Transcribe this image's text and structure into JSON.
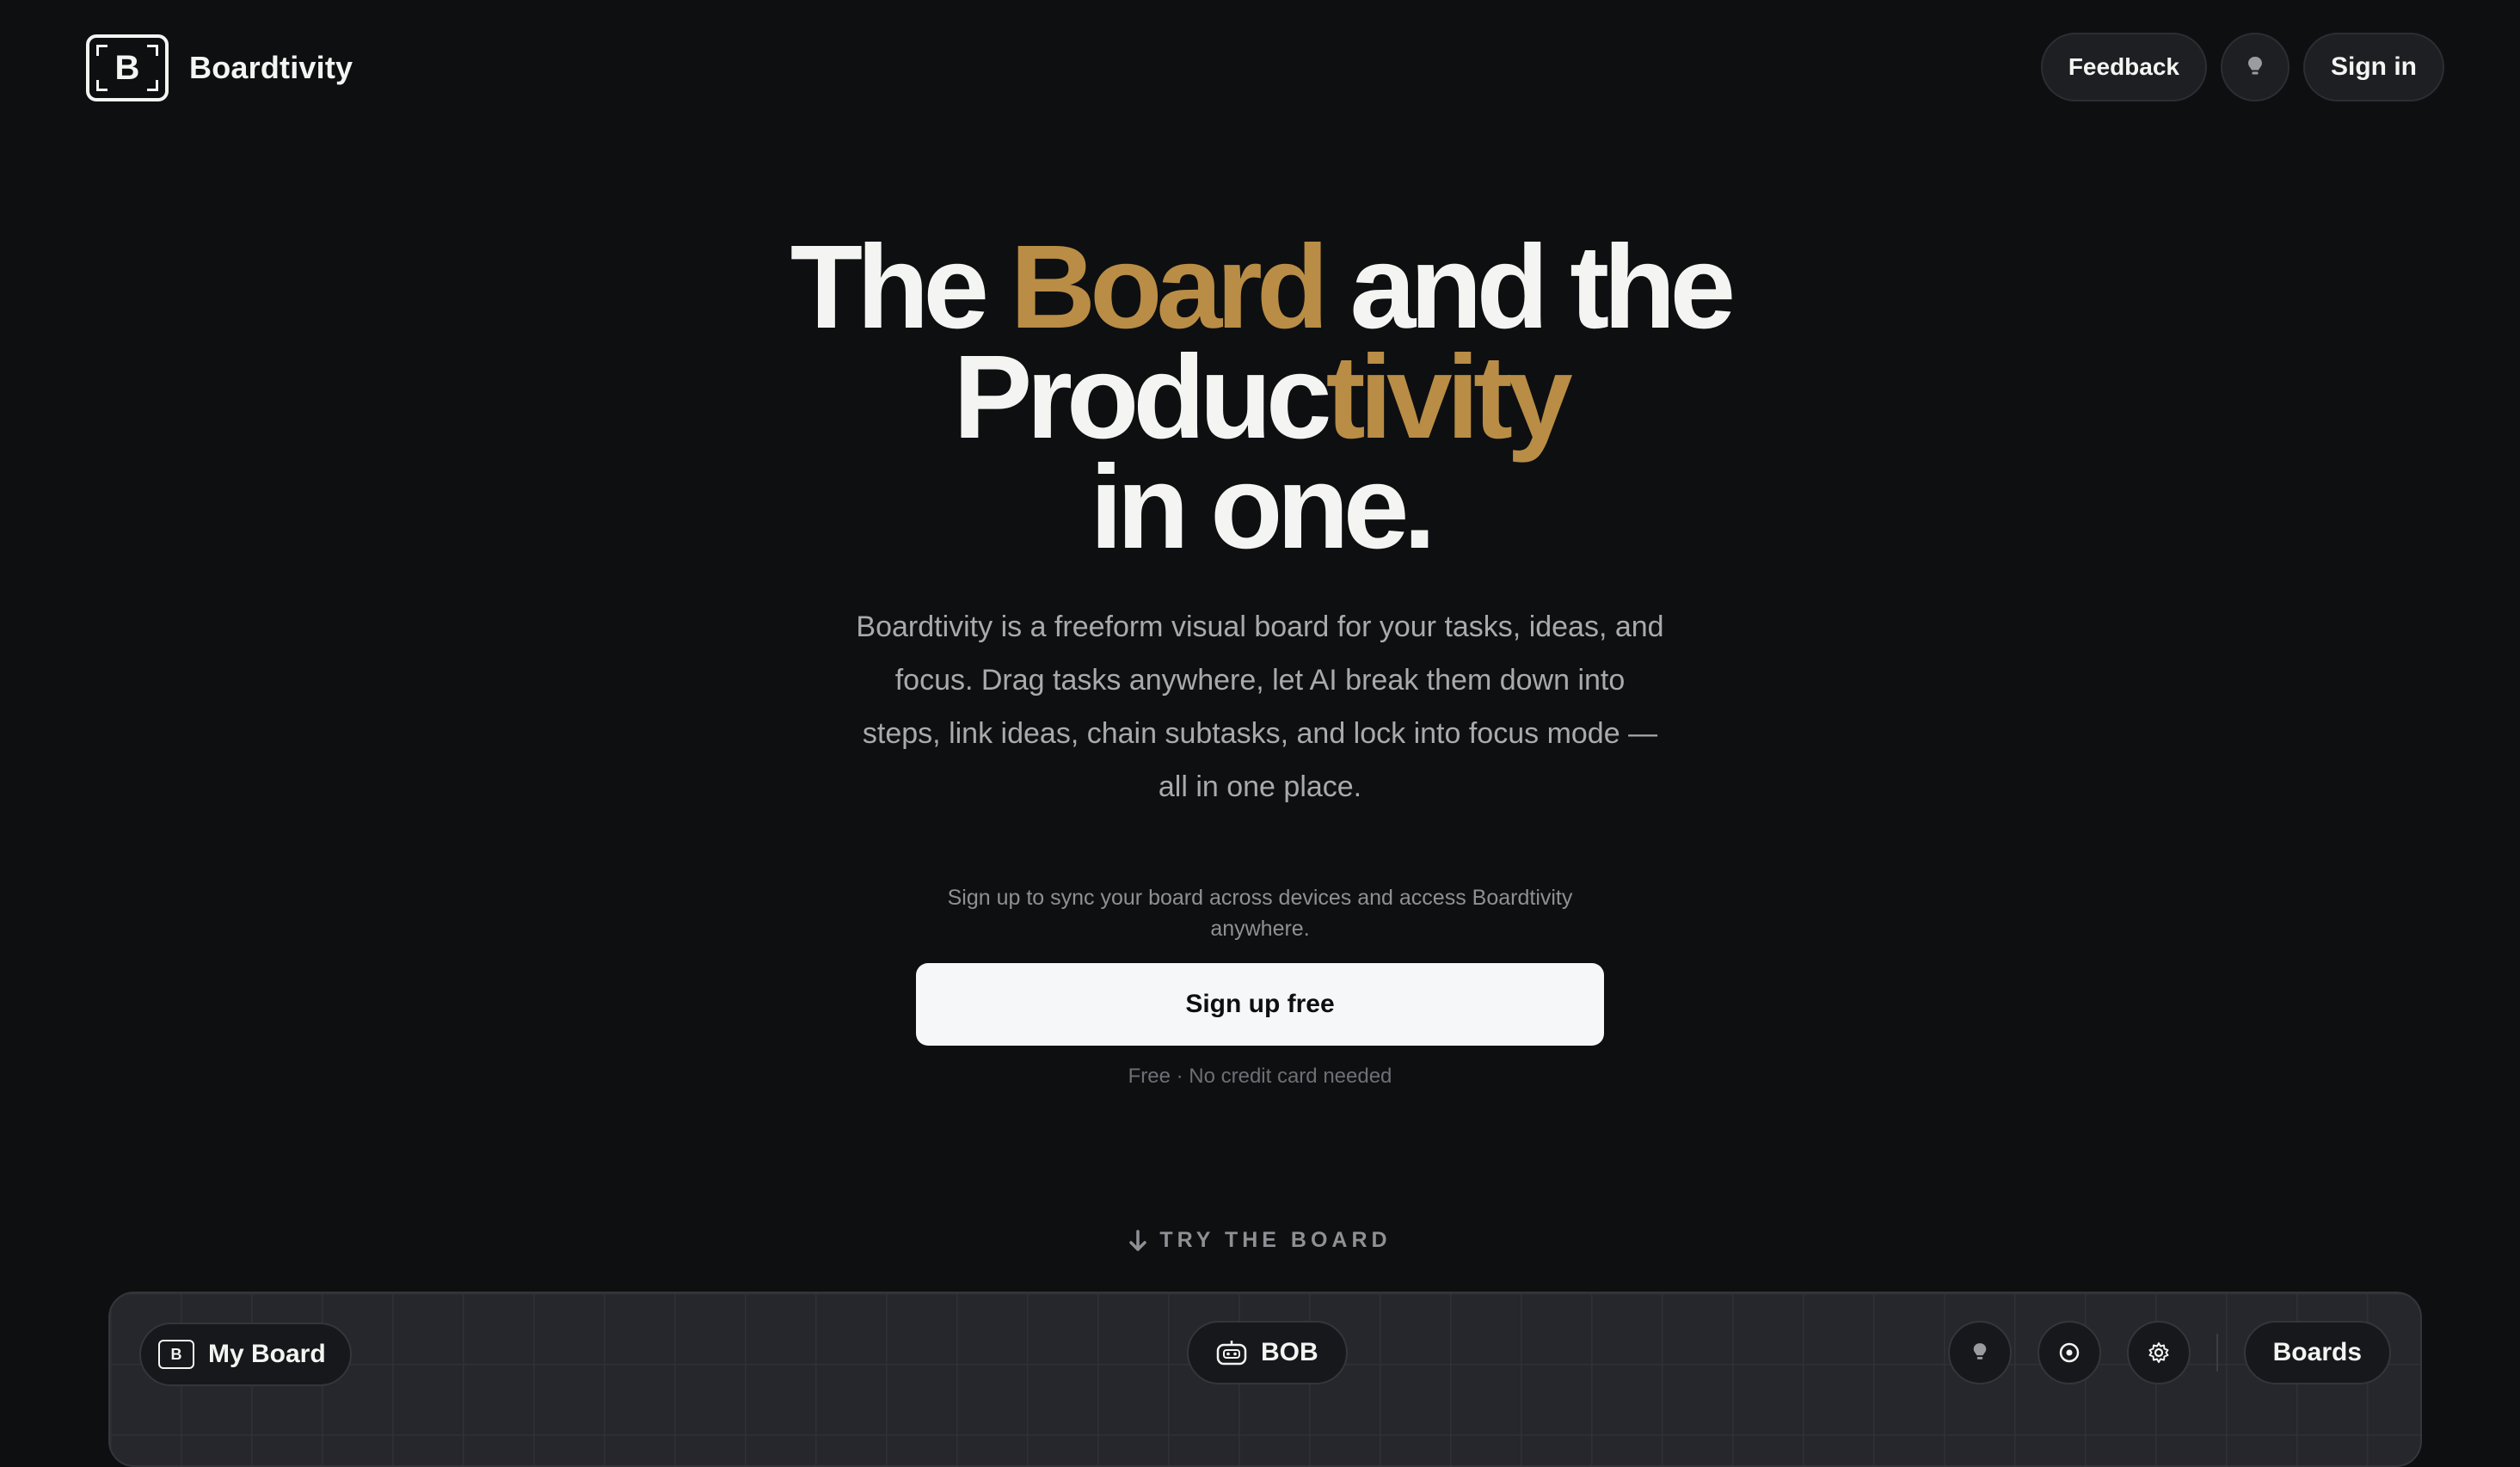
{
  "nav": {
    "brand_letter": "B",
    "brand_name": "Boardtivity",
    "feedback_label": "Feedback",
    "theme_icon": "lightbulb-icon",
    "signin_label": "Sign in"
  },
  "hero": {
    "headline": {
      "line1_a": "The ",
      "line1_gold": "Board",
      "line1_b": " and the",
      "line2_a": "Produc",
      "line2_gold": "tivity",
      "line3": "in one."
    },
    "description": "Boardtivity is a freeform visual board for your tasks, ideas, and focus. Drag tasks anywhere, let AI break them down into steps, link ideas, chain subtasks, and lock into focus mode — all in one place.",
    "signup_note": "Sign up to sync your board across devices and access Boardtivity anywhere.",
    "cta_label": "Sign up free",
    "fine_print": "Free · No credit card needed"
  },
  "try_section": {
    "label": "TRY THE BOARD",
    "icon": "arrow-down-icon"
  },
  "board_preview": {
    "board_letter": "B",
    "board_name": "My Board",
    "assistant_label": "BOB",
    "boards_label": "Boards"
  },
  "colors": {
    "background": "#0e0f11",
    "accent_gold": "#b98d45",
    "text_primary": "#f4f4f2",
    "text_muted": "#a9aaad",
    "cta_bg": "#f6f7f9"
  }
}
